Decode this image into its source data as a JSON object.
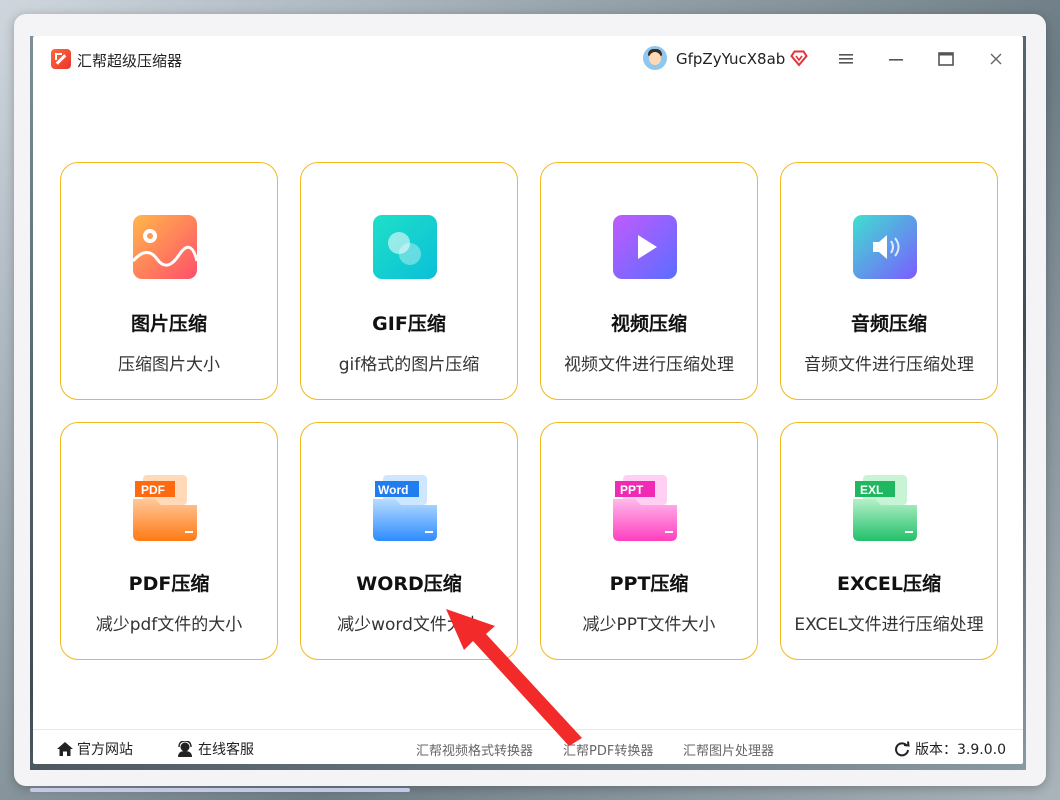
{
  "app": {
    "title": "汇帮超级压缩器"
  },
  "user": {
    "name": "GfpZyYucX8ab"
  },
  "window_controls": [
    "menu",
    "minimize",
    "maximize",
    "close"
  ],
  "cards": [
    {
      "id": "image",
      "title": "图片压缩",
      "desc": "压缩图片大小",
      "icon": "image-icon",
      "colors": [
        "#ffb74a",
        "#ff4f6b"
      ]
    },
    {
      "id": "gif",
      "title": "GIF压缩",
      "desc": "gif格式的图片压缩",
      "icon": "gif-icon",
      "colors": [
        "#1fe0c8",
        "#0bbfd8"
      ]
    },
    {
      "id": "video",
      "title": "视频压缩",
      "desc": "视频文件进行压缩处理",
      "icon": "video-play-icon",
      "colors": [
        "#c05bff",
        "#5b6dff"
      ]
    },
    {
      "id": "audio",
      "title": "音频压缩",
      "desc": "音频文件进行压缩处理",
      "icon": "audio-speaker-icon",
      "colors": [
        "#3ee0d0",
        "#7b5cff"
      ]
    },
    {
      "id": "pdf",
      "title": "PDF压缩",
      "desc": "减少pdf文件的大小",
      "icon": "pdf-folder-icon",
      "badge": "PDF",
      "colors": [
        "#ffc89a",
        "#ff7a14"
      ]
    },
    {
      "id": "word",
      "title": "WORD压缩",
      "desc": "减少word文件大小",
      "icon": "word-folder-icon",
      "badge": "Word",
      "colors": [
        "#b8dcff",
        "#2d8cff"
      ]
    },
    {
      "id": "ppt",
      "title": "PPT压缩",
      "desc": "减少PPT文件大小",
      "icon": "ppt-folder-icon",
      "badge": "PPT",
      "colors": [
        "#ffb8ec",
        "#ff3fbf"
      ]
    },
    {
      "id": "excel",
      "title": "EXCEL压缩",
      "desc": "EXCEL文件进行压缩处理",
      "icon": "excel-folder-icon",
      "badge": "EXL",
      "colors": [
        "#b4f0c8",
        "#22c06a"
      ]
    }
  ],
  "footer": {
    "website": "官方网站",
    "support": "在线客服",
    "links": [
      "汇帮视频格式转换器",
      "汇帮PDF转换器",
      "汇帮图片处理器"
    ],
    "version": "版本：3.9.0.0"
  },
  "annotation": {
    "type": "red-arrow",
    "color": "#f22a2a"
  }
}
